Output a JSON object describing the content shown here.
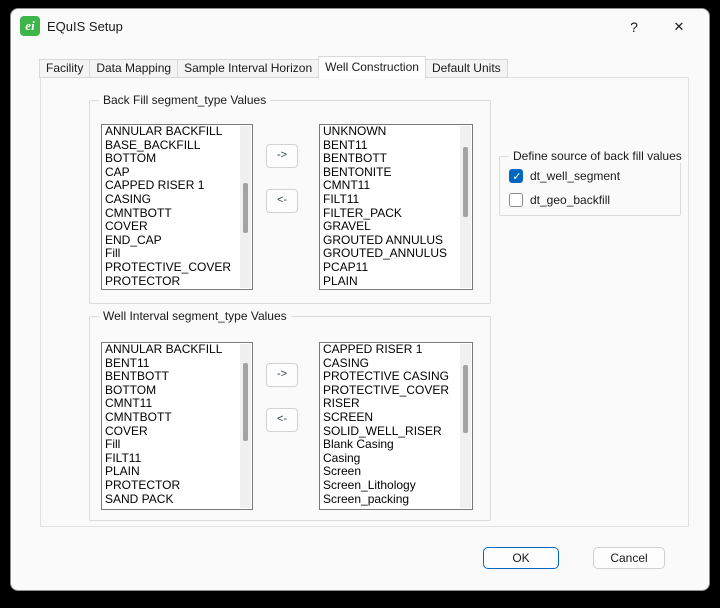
{
  "window": {
    "title": "EQuIS Setup",
    "icon_text": "ei",
    "help_glyph": "?",
    "close_glyph": "✕"
  },
  "tabs": {
    "items": [
      "Facility",
      "Data Mapping",
      "Sample Interval Horizon",
      "Well Construction",
      "Default Units"
    ],
    "active_index": 3,
    "active_label": "Well Construction"
  },
  "back_fill_group": {
    "title": "Back Fill segment_type Values",
    "left_items": [
      "ANNULAR BACKFILL",
      "BASE_BACKFILL",
      "BOTTOM",
      "CAP",
      "CAPPED RISER 1",
      "CASING",
      "CMNTBOTT",
      "COVER",
      "END_CAP",
      "Fill",
      "PROTECTIVE_COVER",
      "PROTECTOR"
    ],
    "right_items": [
      "UNKNOWN",
      "BENT11",
      "BENTBOTT",
      "BENTONITE",
      "CMNT11",
      "FILT11",
      "FILTER_PACK",
      "GRAVEL",
      "GROUTED ANNULUS",
      "GROUTED_ANNULUS",
      "PCAP11",
      "PLAIN"
    ],
    "move_right_label": "->",
    "move_left_label": "<-"
  },
  "source_group": {
    "title": "Define source of back fill values",
    "checkboxes": [
      {
        "label": "dt_well_segment",
        "checked": true
      },
      {
        "label": "dt_geo_backfill",
        "checked": false
      }
    ]
  },
  "well_interval_group": {
    "title": "Well Interval segment_type Values",
    "left_items": [
      "ANNULAR BACKFILL",
      "BENT11",
      "BENTBOTT",
      "BOTTOM",
      "CMNT11",
      "CMNTBOTT",
      "COVER",
      "Fill",
      "FILT11",
      "PLAIN",
      "PROTECTOR",
      "SAND PACK"
    ],
    "right_items": [
      "CAPPED RISER 1",
      "CASING",
      "PROTECTIVE CASING",
      "PROTECTIVE_COVER",
      "RISER",
      "SCREEN",
      "SOLID_WELL_RISER",
      "Blank Casing",
      "Casing",
      "Screen",
      "Screen_Lithology",
      "Screen_packing"
    ],
    "move_right_label": "->",
    "move_left_label": "<-"
  },
  "footer": {
    "ok_label": "OK",
    "cancel_label": "Cancel"
  },
  "colors": {
    "accent": "#0067c0",
    "icon_green": "#3db54a",
    "window_bg": "#fafafa",
    "list_border": "#7a7a7a",
    "group_border": "#dcdcdc"
  }
}
